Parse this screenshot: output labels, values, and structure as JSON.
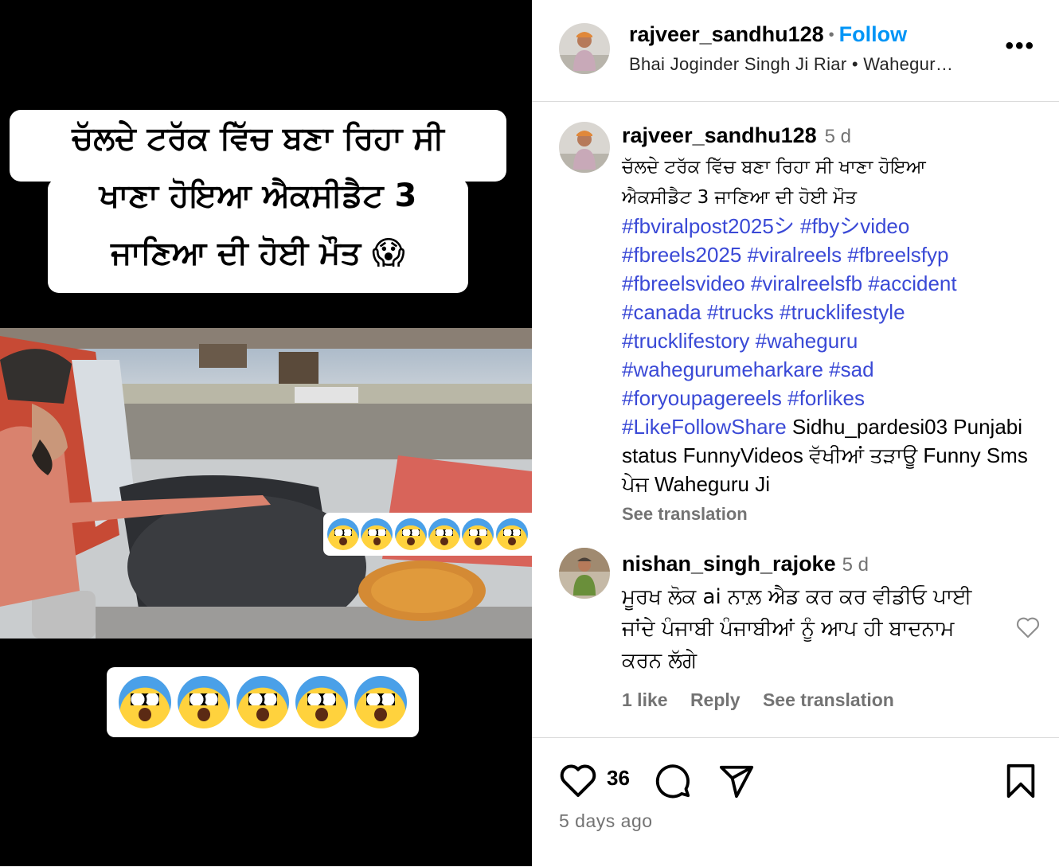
{
  "post": {
    "overlay_text_lines": [
      "ਚੱਲਦੇ ਟਰੱਕ ਵਿੱਚ ਬਣਾ ਰਿਹਾ ਸੀ",
      "ਖਾਣਾ ਹੋਇਆ ਐਕਸੀਡੈਟ 3",
      "ਜਾਣਿਆ ਦੀ ਹੋਈ ਮੌਤ 😱"
    ]
  },
  "header": {
    "username": "rajveer_sandhu128",
    "separator": "•",
    "follow_label": "Follow",
    "audio_text": "Bhai Joginder Singh Ji Riar • Wahegur…",
    "more_label": "•••"
  },
  "caption": {
    "username": "rajveer_sandhu128",
    "time": "5 d",
    "text_line1": "ਚੱਲਦੇ ਟਰੱਕ ਵਿੱਚ ਬਣਾ ਰਿਹਾ ਸੀ ਖਾਣਾ ਹੋਇਆ",
    "text_line2": "ਐਕਸੀਡੈਟ 3 ਜਾਣਿਆ ਦੀ ਹੋਈ ਮੌਤ",
    "hashtags": [
      "#fbviralpost2025シ",
      "#fbyシvideo",
      "#fbreels2025",
      "#viralreels",
      "#fbreelsfyp",
      "#fbreelsvideo",
      "#viralreelsfb",
      "#accident",
      "#canada",
      "#trucks",
      "#trucklifestyle",
      "#trucklifestory",
      "#waheguru",
      "#wahegurumeharkare",
      "#sad",
      "#foryoupagereels",
      "#forlikes",
      "#LikeFollowShare"
    ],
    "tail_text": "Sidhu_pardesi03 Punjabi status FunnyVideos ਵੱਖੀਆਂ ਤੜਾਊ Funny Sms ਪੇਜ Waheguru Ji",
    "see_translation": "See translation"
  },
  "comment": {
    "username": "nishan_singh_rajoke",
    "time": "5 d",
    "text": "ਮੂਰਖ ਲੋਕ ai ਨਾਲ਼ ਐਡ ਕਰ ਕਰ ਵੀਡੀਓ ਪਾਈ ਜਾਂਦੇ ਪੰਜਾਬੀ ਪੰਜਾਬੀਆਂ ਨੂੰ ਆਪ ਹੀ ਬਾਦਨਾਮ ਕਰਨ ਲੱਗੇ",
    "likes": "1 like",
    "reply": "Reply",
    "see_translation": "See translation"
  },
  "footer": {
    "like_count": "36",
    "time_ago": "5 days ago"
  },
  "colors": {
    "follow": "#0095f6",
    "hashtag": "#3a49d6",
    "muted": "#737373",
    "divider": "#dbdbdb"
  },
  "icons": [
    "heart-icon",
    "comment-icon",
    "share-icon",
    "bookmark-icon",
    "more-icon"
  ]
}
